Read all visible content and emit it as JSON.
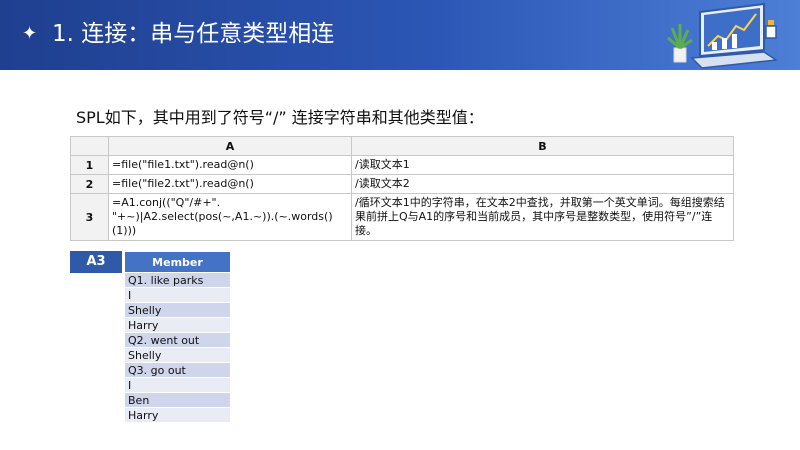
{
  "header": {
    "star": "✦",
    "title": "1. 连接：串与任意类型相连"
  },
  "intro": "SPL如下，其中用到了符号“/” 连接字符串和其他类型值：",
  "grid": {
    "col_headers": [
      "A",
      "B"
    ],
    "rows": [
      {
        "num": "1",
        "a": "=file(\"file1.txt\").read@n()",
        "b": "/读取文本1"
      },
      {
        "num": "2",
        "a": "=file(\"file2.txt\").read@n()",
        "b": "/读取文本2"
      },
      {
        "num": "3",
        "a": "=A1.conj((\"Q\"/#+\". \"+~)|A2.select(pos(~,A1.~)).(~.words()(1)))",
        "b": "/循环文本1中的字符串，在文本2中查找，并取第一个英文单词。每组搜索结果前拼上Q与A1的序号和当前成员，其中序号是整数类型，使用符号”/”连接。"
      }
    ]
  },
  "result": {
    "cell_label": "A3",
    "column_header": "Member",
    "items": [
      "Q1. like parks",
      "I",
      "Shelly",
      "Harry",
      "Q2. went out",
      "Shelly",
      "Q3. go out",
      "I",
      "Ben",
      "Harry"
    ]
  },
  "colors": {
    "header_blue": "#2c57b6",
    "member_header": "#4472c4",
    "row_odd": "#cfd5ea",
    "row_even": "#e9ebf5"
  }
}
